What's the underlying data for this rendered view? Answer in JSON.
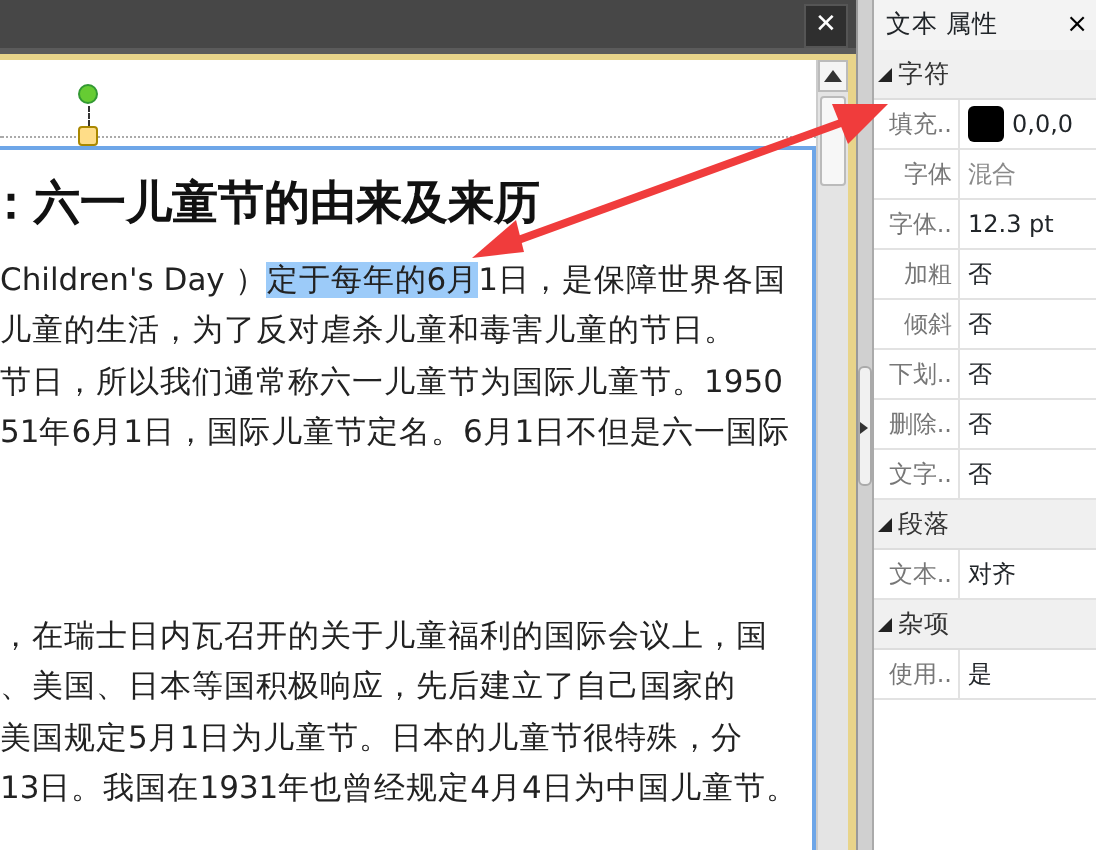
{
  "document": {
    "heading": "：六一儿童节的由来及来历",
    "paragraphs": [
      {
        "lines": [
          {
            "before": "Children's Day ）",
            "selected": "定于每年的6月",
            "after": "1日，是保障世界各国"
          },
          {
            "before": "儿童的生活，为了反对虐杀儿童和毒害儿童的节日。"
          },
          {
            "before": "节日，所以我们通常称六一儿童节为国际儿童节。1950"
          },
          {
            "before": "51年6月1日，国际儿童节定名。6月1日不但是六一国际"
          }
        ]
      },
      {
        "lines": [
          {
            "before": "，在瑞士日内瓦召开的关于儿童福利的国际会议上，国"
          },
          {
            "before": "、美国、日本等国积极响应，先后建立了自己国家的"
          },
          {
            "before": "美国规定5月1日为儿童节。日本的儿童节很特殊，分"
          },
          {
            "before": "13日。我国在1931年也曾经规定4月4日为中国儿童节。"
          }
        ]
      }
    ]
  },
  "close_button": "✕",
  "properties_panel": {
    "title": "文本 属性",
    "close": "×",
    "groups": [
      {
        "name": "字符",
        "expanded": true,
        "rows": [
          {
            "kind": "color",
            "label": "填充..",
            "value": "0,0,0",
            "color": "#000000"
          },
          {
            "kind": "text",
            "label": "字体",
            "value": "混合",
            "mixed": true
          },
          {
            "kind": "text",
            "label": "字体..",
            "value": "12.3 pt",
            "mixed": false
          },
          {
            "kind": "text",
            "label": "加粗",
            "value": "否",
            "mixed": false
          },
          {
            "kind": "text",
            "label": "倾斜",
            "value": "否",
            "mixed": false
          },
          {
            "kind": "text",
            "label": "下划..",
            "value": "否",
            "mixed": false
          },
          {
            "kind": "text",
            "label": "删除..",
            "value": "否",
            "mixed": false
          },
          {
            "kind": "text",
            "label": "文字..",
            "value": "否",
            "mixed": false
          }
        ]
      },
      {
        "name": "段落",
        "expanded": true,
        "rows": [
          {
            "kind": "text",
            "label": "文本..",
            "value": "对齐",
            "mixed": false
          }
        ]
      },
      {
        "name": "杂项",
        "expanded": true,
        "rows": [
          {
            "kind": "text",
            "label": "使用..",
            "value": "是",
            "mixed": false
          }
        ]
      }
    ]
  }
}
